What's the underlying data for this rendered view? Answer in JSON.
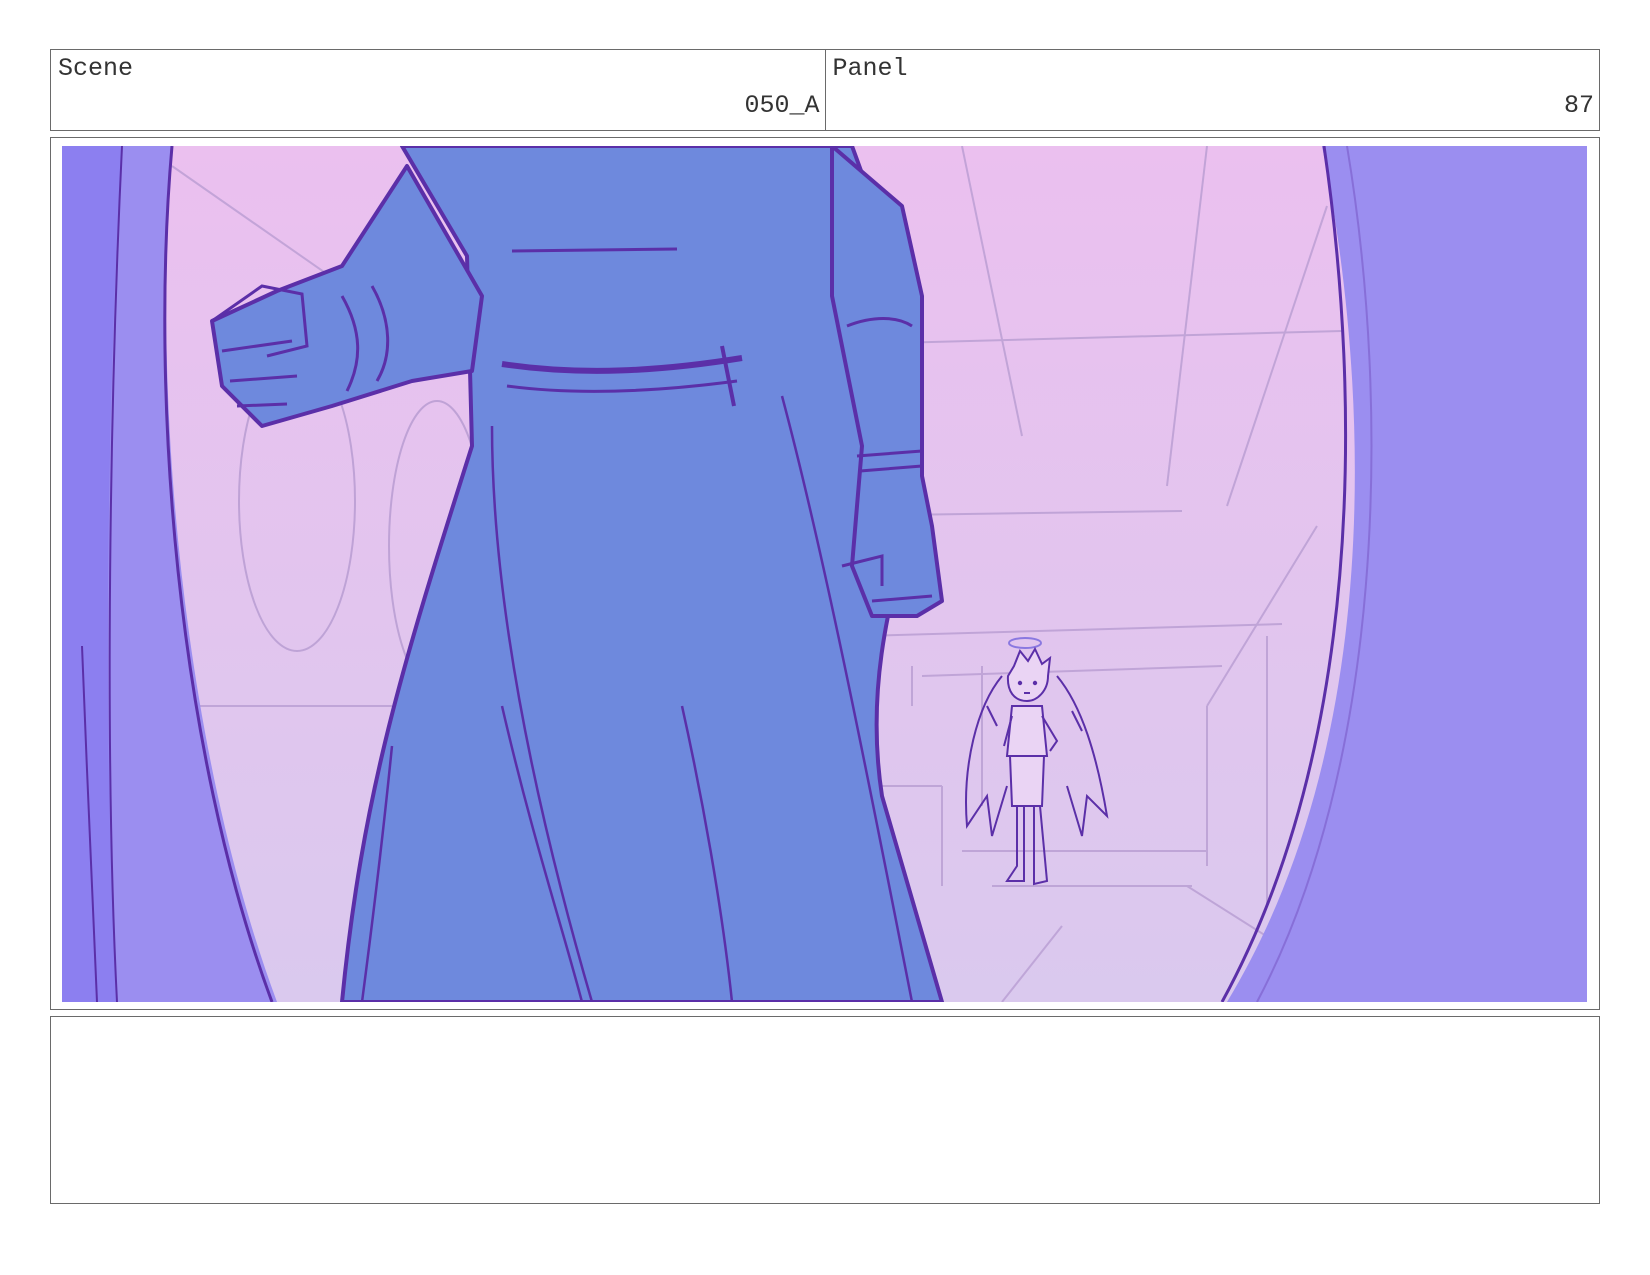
{
  "header": {
    "scene_label": "Scene",
    "scene_value": "050_A",
    "panel_label": "Panel",
    "panel_value": "87"
  },
  "notes": {
    "text": ""
  },
  "colors": {
    "sky_top": "#ebc0ef",
    "sky_bottom": "#dcc9ee",
    "door": "#9b8ef0",
    "figure": "#6e89dd",
    "line": "#5b2fa8"
  }
}
